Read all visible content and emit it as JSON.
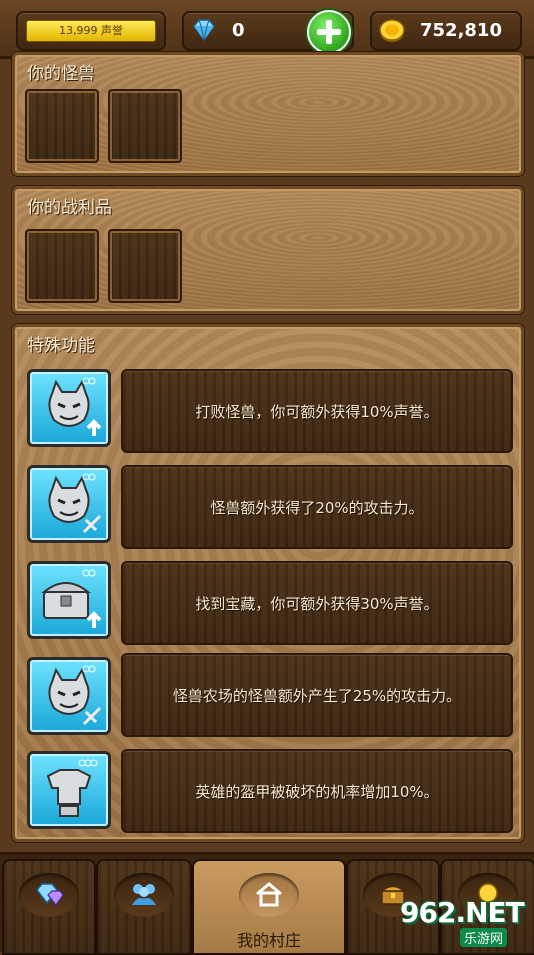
{
  "topbar": {
    "fame": "13,999 声誉",
    "gems": "0",
    "gold": "752,810"
  },
  "panels": {
    "monsters_title": "你的怪兽",
    "loot_title": "你的战利品",
    "special_title": "特殊功能"
  },
  "features": [
    {
      "icon": "monster-boost-icon",
      "text": "打败怪兽，你可额外获得10%声誉。"
    },
    {
      "icon": "monster-sword-icon",
      "text": "怪兽额外获得了20%的攻击力。"
    },
    {
      "icon": "treasure-chest-boost-icon",
      "text": "找到宝藏，你可额外获得30%声誉。"
    },
    {
      "icon": "monster-sword-icon",
      "text": "怪兽农场的怪兽额外产生了25%的攻击力。"
    },
    {
      "icon": "armor-icon",
      "text": "英雄的盔甲被破坏的机率增加10%。"
    }
  ],
  "nav": {
    "village_label": "我的村庄"
  },
  "watermark": {
    "logo": "962.NET",
    "sub": "乐游网"
  },
  "colors": {
    "fame_bar": "#e3b500",
    "add_button": "#2fa51c",
    "feature_icon_bg": "#1aa7d8"
  }
}
